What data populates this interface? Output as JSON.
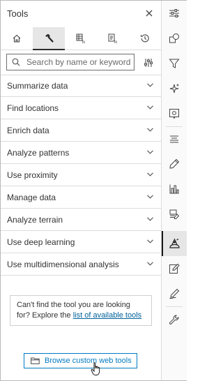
{
  "panel": {
    "title": "Tools",
    "close_icon": "close-icon"
  },
  "tabs": [
    {
      "icon": "home-icon",
      "active": false
    },
    {
      "icon": "hammer-icon",
      "active": true
    },
    {
      "icon": "table-fx-icon",
      "active": false
    },
    {
      "icon": "doc-fx-icon",
      "active": false
    },
    {
      "icon": "history-icon",
      "active": false
    }
  ],
  "search": {
    "placeholder": "Search by name or keyword",
    "value": "",
    "filter_icon": "sliders-icon"
  },
  "categories": [
    {
      "label": "Summarize data"
    },
    {
      "label": "Find locations"
    },
    {
      "label": "Enrich data"
    },
    {
      "label": "Analyze patterns"
    },
    {
      "label": "Use proximity"
    },
    {
      "label": "Manage data"
    },
    {
      "label": "Analyze terrain"
    },
    {
      "label": "Use deep learning"
    },
    {
      "label": "Use multidimensional analysis"
    }
  ],
  "tip": {
    "text": "Can't find the tool you are looking for? Explore the ",
    "link": "list of available tools"
  },
  "browse": {
    "label": "Browse custom web tools",
    "icon": "folder-icon"
  },
  "toolbar": [
    {
      "icon": "sliders-horizontal-icon",
      "active": false
    },
    {
      "icon": "shapes-icon",
      "active": false
    },
    {
      "icon": "filter-icon",
      "active": false
    },
    {
      "icon": "sparkle-icon",
      "active": false
    },
    {
      "icon": "popup-icon",
      "active": false
    },
    {
      "icon": "labels-icon",
      "active": false
    },
    {
      "icon": "pencil-tag-icon",
      "active": false
    },
    {
      "icon": "chart-icon",
      "active": false
    },
    {
      "icon": "layers-edit-icon",
      "active": false
    },
    {
      "icon": "analysis-icon",
      "active": true
    },
    {
      "icon": "edit-icon",
      "active": false
    },
    {
      "icon": "sketch-icon",
      "active": false
    },
    {
      "icon": "wrench-icon",
      "active": false
    }
  ],
  "colors": {
    "accent": "#007ac2",
    "link": "#00619b",
    "text": "#323232",
    "active_bg": "#e6e6e6"
  }
}
